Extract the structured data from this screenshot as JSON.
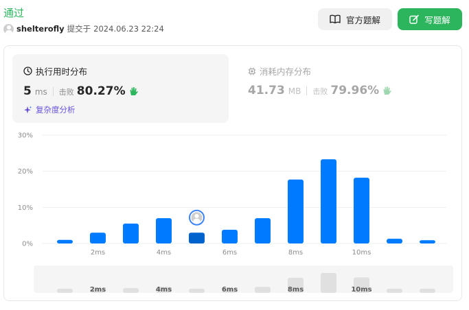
{
  "header": {
    "status": "通过",
    "user": "shelterofly",
    "submitted_label": "提交于",
    "timestamp": "2024.06.23 22:24"
  },
  "buttons": {
    "official_solution": "官方题解",
    "write_solution": "写题解"
  },
  "runtime": {
    "title": "执行用时分布",
    "value": "5",
    "unit": "ms",
    "beats_label": "击败",
    "beats_pct": "80.27%",
    "complexity_label": "复杂度分析"
  },
  "memory": {
    "title": "消耗内存分布",
    "value": "41.73",
    "unit": "MB",
    "beats_label": "击败",
    "beats_pct": "79.96%"
  },
  "colors": {
    "accent_green": "#2db55d",
    "bar_blue": "#007aff",
    "bar_highlight": "#0062cc",
    "minimap_bar": "#e0e0e0"
  },
  "chart_data": {
    "type": "bar",
    "x": [
      1,
      2,
      3,
      4,
      5,
      6,
      7,
      8,
      9,
      10,
      11,
      12
    ],
    "values": [
      1,
      3,
      5.5,
      7,
      3,
      3.8,
      7,
      17.7,
      23.3,
      18.2,
      1.3,
      0.9
    ],
    "highlight_x": 5,
    "xlabel": "",
    "ylabel": "",
    "ylim": [
      0,
      30
    ],
    "yticks": [
      "0%",
      "10%",
      "20%",
      "30%"
    ],
    "xticks": [
      "2ms",
      "4ms",
      "6ms",
      "8ms",
      "10ms"
    ],
    "grid": true
  }
}
